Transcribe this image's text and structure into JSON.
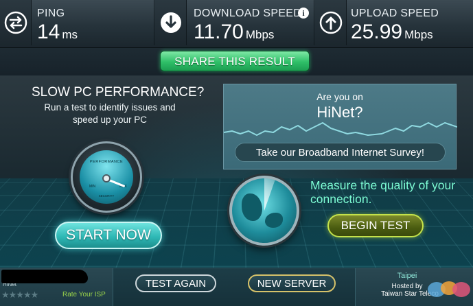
{
  "stats": {
    "ping": {
      "label": "PING",
      "value": "14",
      "unit": "ms",
      "icon": "exchange-arrows-icon"
    },
    "download": {
      "label": "DOWNLOAD SPEED",
      "value": "11.70",
      "unit": "Mbps",
      "icon": "download-arrow-icon"
    },
    "upload": {
      "label": "UPLOAD SPEED",
      "value": "25.99",
      "unit": "Mbps",
      "icon": "upload-arrow-icon"
    }
  },
  "share": {
    "label": "SHARE THIS RESULT"
  },
  "promo": {
    "title": "SLOW PC PERFORMANCE?",
    "subtitle": "Run a test to identify issues and speed up your PC",
    "gauge_title": "PERFORMANCE",
    "gauge_min": "MIN",
    "gauge_max": "MAX",
    "gauge_caption": "SECURITY",
    "button": "START NOW"
  },
  "survey": {
    "question_line1": "Are you on",
    "question_line2": "HiNet?",
    "cta": "Take our Broadband Internet Survey!"
  },
  "measure": {
    "text": "Measure the quality of your connection.",
    "button": "BEGIN TEST"
  },
  "isp": {
    "name": "HiNet",
    "stars": "★★★★★",
    "rate_label": "Rate Your ISP"
  },
  "actions": {
    "test_again": "TEST AGAIN",
    "new_server": "NEW SERVER"
  },
  "server": {
    "city": "Taipei",
    "hosted_by": "Hosted by",
    "host": "Taiwan Star Teleco"
  },
  "colors": {
    "share_green": "#2fbf68",
    "start_teal": "#2fb9b6",
    "measure_text": "#7dfcd4",
    "begin_border": "#c4e24a",
    "rate_isp": "#9cd64a"
  }
}
